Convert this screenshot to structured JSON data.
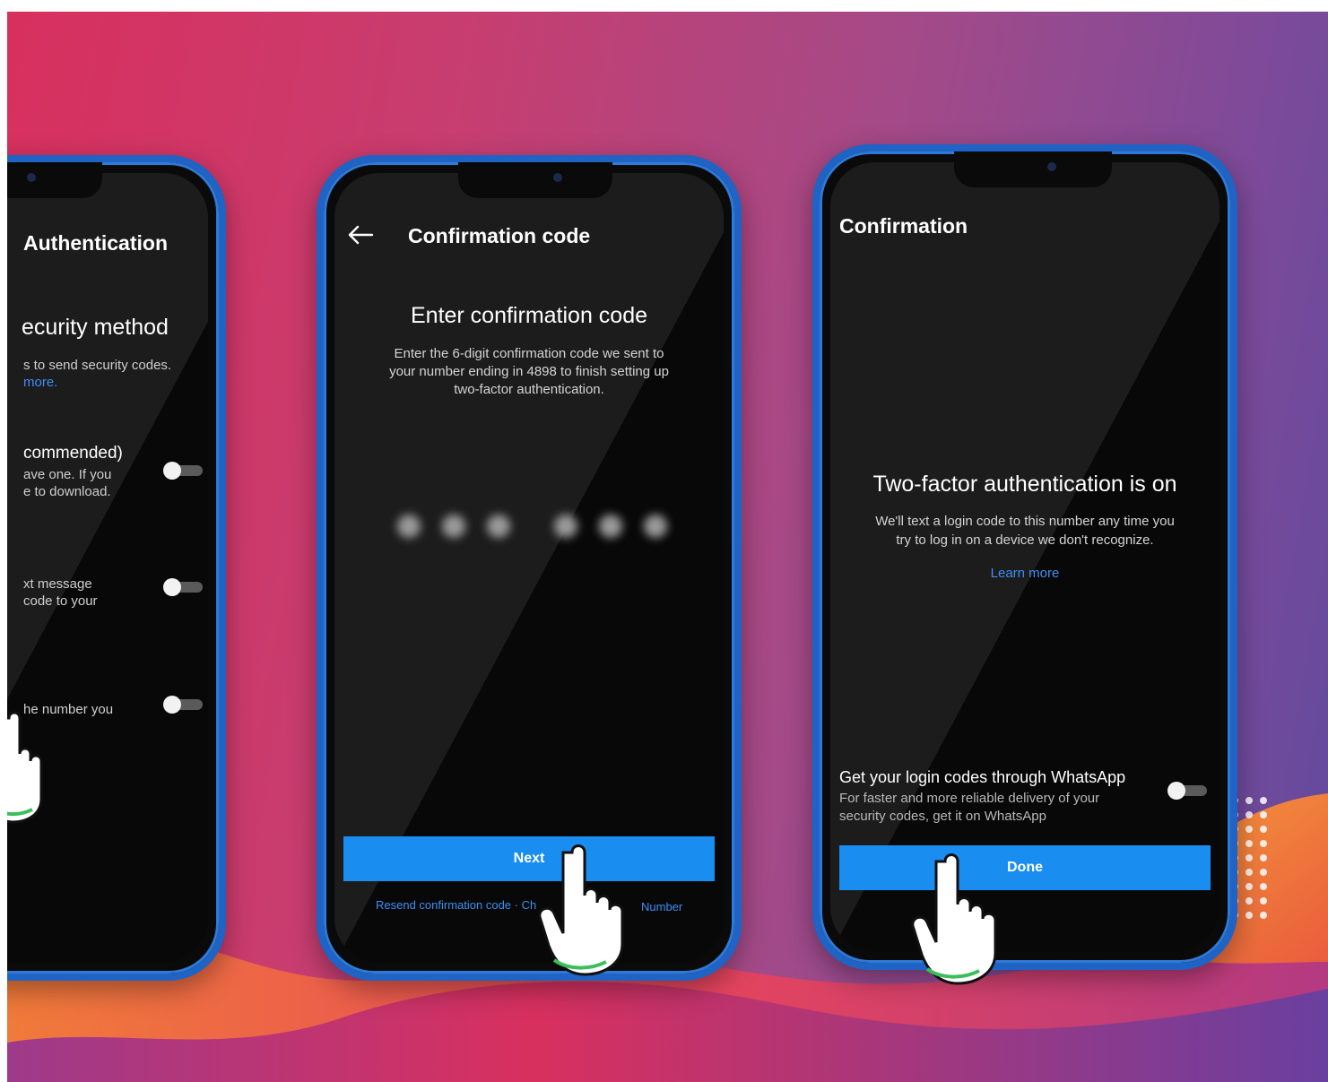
{
  "phone_left": {
    "title": "Authentication",
    "heading": "ecurity method",
    "desc_line1": "s to send security codes.",
    "desc_line2": "more.",
    "option1_title": "commended)",
    "option1_line1": "ave one. If you",
    "option1_line2": "e to download.",
    "option2_line1": "xt message",
    "option2_line2": "code to your",
    "option3_line1": "he number you"
  },
  "phone_middle": {
    "back_icon": "arrow-left-icon",
    "title": "Confirmation code",
    "heading": "Enter confirmation code",
    "desc_line1": "Enter the 6-digit confirmation code we sent to",
    "desc_line2": "your number ending in 4898 to finish setting up",
    "desc_line3": "two-factor authentication.",
    "next_label": "Next",
    "resend_text": "Resend confirmation code · Ch",
    "change_number_tail": "Number"
  },
  "phone_right": {
    "title": "Confirmation",
    "heading": "Two-factor authentication is on",
    "desc_line1": "We'll text a login code to this number any time you",
    "desc_line2": "try to log in on a device we don't recognize.",
    "learn_more": "Learn more",
    "whatsapp_title": "Get your login codes through WhatsApp",
    "whatsapp_line1": "For faster and more reliable delivery of your",
    "whatsapp_line2": "security codes, get it on WhatsApp",
    "done_label": "Done"
  },
  "colors": {
    "accent_blue": "#1a8ef0",
    "link_blue": "#3d8ef5",
    "phone_frame": "#1f63c4",
    "background_pink": "#d8305e",
    "background_purple": "#5f4a9e",
    "wave_orange": "#f07a3a"
  }
}
